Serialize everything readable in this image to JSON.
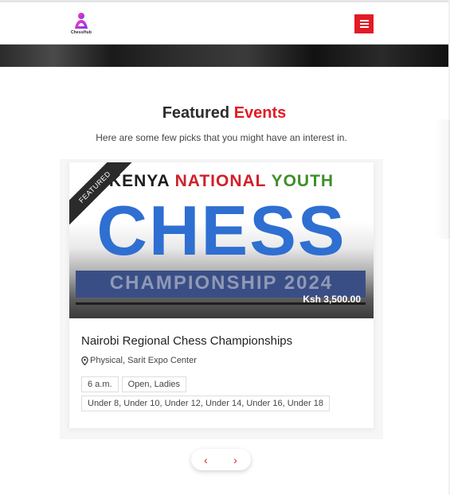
{
  "header": {
    "logo_text": "ChessHub",
    "menu_icon": "hamburger-icon",
    "accent_color": "#e21b25"
  },
  "section": {
    "title_main": "Featured",
    "title_accent": "Events",
    "subtitle": "Here are some few picks that you might have an interest in."
  },
  "event": {
    "image_text": {
      "line1_word1": "KENYA",
      "line1_word2": "NATIONAL",
      "line1_word3": "YOUTH",
      "line2": "CHESS",
      "line3": "CHAMPIONSHIP 2024"
    },
    "badge": "FEATURED",
    "price": "Ksh 3,500.00",
    "title": "Nairobi Regional Chess Championships",
    "location_icon": "map-pin-icon",
    "location": "Physical, Sarit Expo Center",
    "time": "6 a.m.",
    "categories": "Open, Ladies",
    "age_groups": "Under 8, Under 10, Under 12, Under 14, Under 16, Under 18"
  },
  "carousel": {
    "prev_glyph": "‹",
    "next_glyph": "›"
  }
}
